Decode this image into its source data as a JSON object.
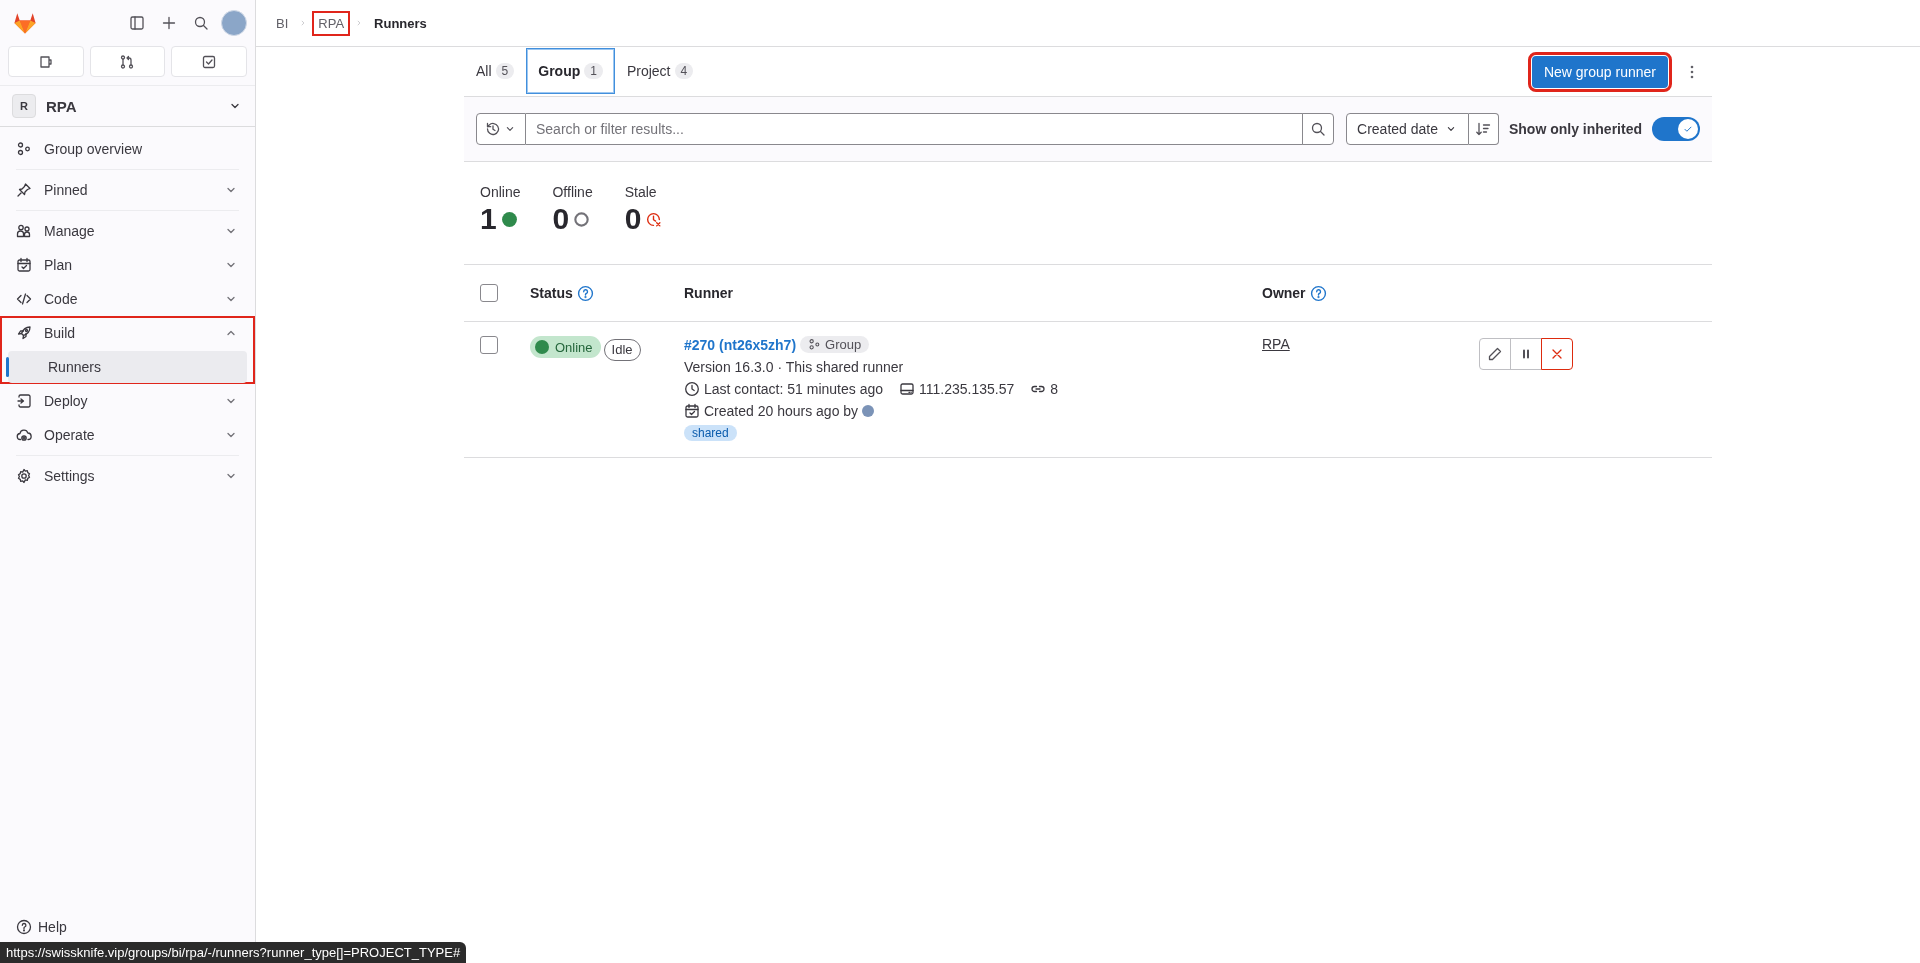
{
  "sidebar": {
    "group": {
      "avatar_letter": "R",
      "name": "RPA"
    },
    "items": [
      {
        "label": "Group overview",
        "kind": "link"
      },
      {
        "label": "Pinned",
        "kind": "section",
        "expanded": false
      },
      {
        "label": "Manage",
        "kind": "section",
        "expanded": false
      },
      {
        "label": "Plan",
        "kind": "section",
        "expanded": false
      },
      {
        "label": "Code",
        "kind": "section",
        "expanded": false
      },
      {
        "label": "Build",
        "kind": "section",
        "expanded": true,
        "highlighted": true,
        "children": [
          {
            "label": "Runners",
            "selected": true
          }
        ]
      },
      {
        "label": "Deploy",
        "kind": "section",
        "expanded": false
      },
      {
        "label": "Operate",
        "kind": "section",
        "expanded": false
      },
      {
        "label": "Settings",
        "kind": "section",
        "expanded": false
      }
    ],
    "help": "Help"
  },
  "breadcrumb": [
    {
      "label": "BI",
      "current": false,
      "highlighted": false
    },
    {
      "label": "RPA",
      "current": false,
      "highlighted": true
    },
    {
      "label": "Runners",
      "current": true,
      "highlighted": false
    }
  ],
  "tabs": [
    {
      "label": "All",
      "count": "5",
      "selected": false
    },
    {
      "label": "Group",
      "count": "1",
      "selected": true
    },
    {
      "label": "Project",
      "count": "4",
      "selected": false
    }
  ],
  "new_button": {
    "label": "New group runner",
    "highlighted": true
  },
  "filter": {
    "placeholder": "Search or filter results...",
    "sort": "Created date",
    "toggle": {
      "label": "Show only inherited",
      "on": true
    }
  },
  "stats": [
    {
      "label": "Online",
      "value": "1",
      "kind": "online"
    },
    {
      "label": "Offline",
      "value": "0",
      "kind": "offline"
    },
    {
      "label": "Stale",
      "value": "0",
      "kind": "stale"
    }
  ],
  "table": {
    "select_all_checked": false,
    "columns": [
      {
        "label": "Status",
        "help": true
      },
      {
        "label": "Runner",
        "help": false
      },
      {
        "label": "Owner",
        "help": true
      }
    ],
    "rows": [
      {
        "checked": false,
        "status": {
          "label": "Online",
          "kind": "online"
        },
        "state": "Idle",
        "name": "#270 (nt26x5zh7)",
        "type": "Group",
        "version": "Version 16.3.0 · This shared runner",
        "last_contact": "Last contact: 51 minutes ago",
        "ip": "111.235.135.57",
        "jobs": "8",
        "created": "Created 20 hours ago by",
        "tags": [
          "shared"
        ],
        "owner": "RPA"
      }
    ]
  },
  "status_url": "https://swissknife.vip/groups/bi/rpa/-/runners?runner_type[]=PROJECT_TYPE#"
}
